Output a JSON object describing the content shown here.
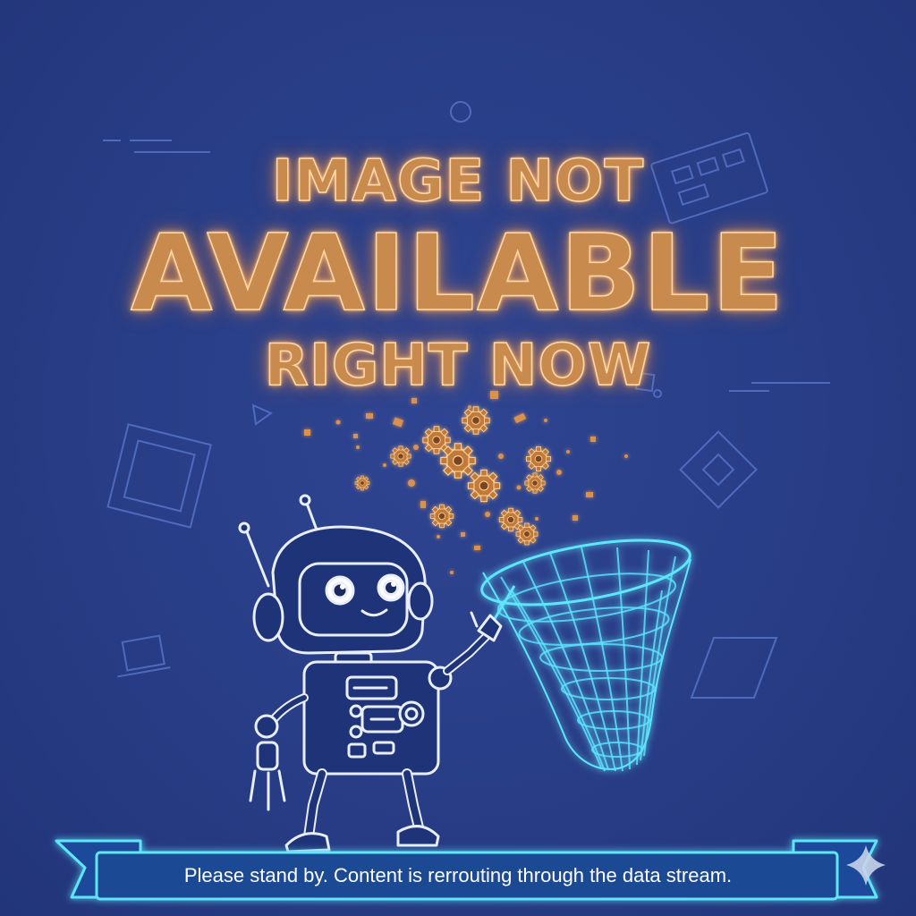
{
  "headline": {
    "line1": "IMAGE NOT",
    "line2": "AVAILABLE",
    "line3": "RIGHT NOW"
  },
  "banner": {
    "message": "Please stand by. Content is rerrouting through the data stream."
  },
  "colors": {
    "background": "#283d86",
    "headline": "#c98a4d",
    "glow": "#ffb46e",
    "net": "#5ee6ff",
    "robot_line": "#e8eefc"
  },
  "icons": [
    "robot-illustration",
    "wire-net-icon",
    "gear-icon",
    "sparkle-icon"
  ]
}
